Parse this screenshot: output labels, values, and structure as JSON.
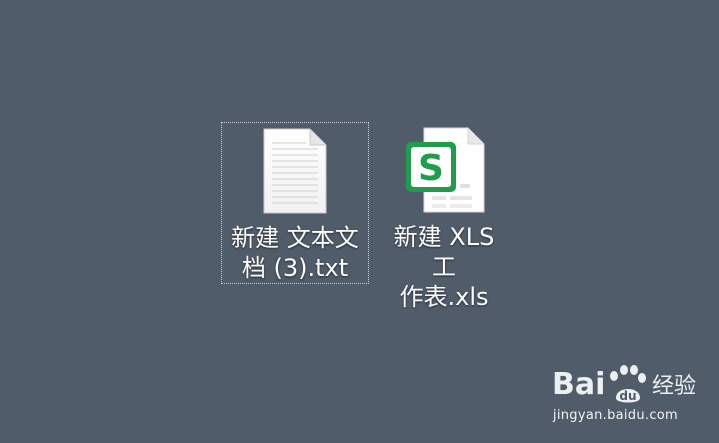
{
  "desktop": {
    "background_color": "#515c6b",
    "icons": [
      {
        "label_line1": "新建 文本文",
        "label_line2": "档 (3).txt",
        "icon": "text-document-icon",
        "selected": true
      },
      {
        "label_line1": "新建 XLS 工",
        "label_line2": "作表.xls",
        "icon": "spreadsheet-icon",
        "accent_color": "#1f9d4c"
      }
    ]
  },
  "watermark": {
    "logo_text": "Bai",
    "logo_text2": "经验",
    "url_text": "jingyan.baidu.com"
  }
}
